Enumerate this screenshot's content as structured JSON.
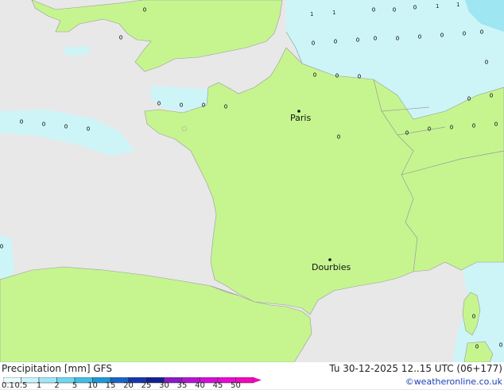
{
  "cities": [
    {
      "name": "Paris"
    },
    {
      "name": "Dourbies"
    }
  ],
  "legend": {
    "title": "Precipitation [mm] GFS",
    "ticks": [
      "0.1",
      "0.5",
      "1",
      "2",
      "5",
      "10",
      "15",
      "20",
      "25",
      "30",
      "35",
      "40",
      "45",
      "50"
    ],
    "colors": [
      "#e8fbff",
      "#c8f4fb",
      "#9ee8f6",
      "#6fd7ef",
      "#3fbfe4",
      "#1f97d6",
      "#1a64c8",
      "#1636b0",
      "#122090",
      "#8a1ac8",
      "#b414d2",
      "#d20ed8",
      "#e80ad2",
      "#f008b8"
    ]
  },
  "run_info": "Tu 30-12-2025 12..15 UTC (06+177)",
  "credit": "©weatheronline.co.uk",
  "colors": {
    "land": "#c6f590",
    "sea": "#e8e8e8",
    "precip_light": "#cdf5f8",
    "precip_med": "#9de6f2"
  }
}
